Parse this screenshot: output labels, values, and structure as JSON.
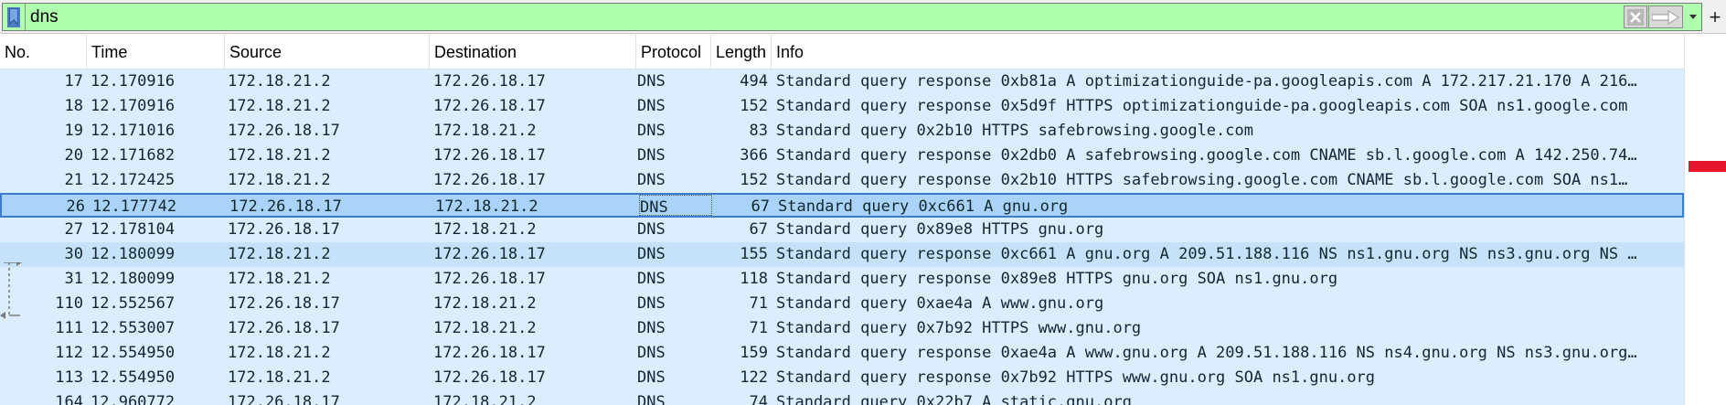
{
  "filter": {
    "value": "dns",
    "placeholder": ""
  },
  "toolbar": {
    "add_label": "+"
  },
  "columns": [
    "No.",
    "Time",
    "Source",
    "Destination",
    "Protocol",
    "Length",
    "Info"
  ],
  "packets": [
    {
      "no": "17",
      "time": "12.170916",
      "src": "172.18.21.2",
      "dst": "172.26.18.17",
      "proto": "DNS",
      "len": "494",
      "info": "Standard query response 0xb81a A optimizationguide-pa.googleapis.com A 172.217.21.170 A 216…",
      "style": "alt"
    },
    {
      "no": "18",
      "time": "12.170916",
      "src": "172.18.21.2",
      "dst": "172.26.18.17",
      "proto": "DNS",
      "len": "152",
      "info": "Standard query response 0x5d9f HTTPS optimizationguide-pa.googleapis.com SOA ns1.google.com",
      "style": "alt"
    },
    {
      "no": "19",
      "time": "12.171016",
      "src": "172.26.18.17",
      "dst": "172.18.21.2",
      "proto": "DNS",
      "len": "83",
      "info": "Standard query 0x2b10 HTTPS safebrowsing.google.com",
      "style": "alt"
    },
    {
      "no": "20",
      "time": "12.171682",
      "src": "172.18.21.2",
      "dst": "172.26.18.17",
      "proto": "DNS",
      "len": "366",
      "info": "Standard query response 0x2db0 A safebrowsing.google.com CNAME sb.l.google.com A 142.250.74…",
      "style": "alt"
    },
    {
      "no": "21",
      "time": "12.172425",
      "src": "172.18.21.2",
      "dst": "172.26.18.17",
      "proto": "DNS",
      "len": "152",
      "info": "Standard query response 0x2b10 HTTPS safebrowsing.google.com CNAME sb.l.google.com SOA ns1…",
      "style": "alt"
    },
    {
      "no": "26",
      "time": "12.177742",
      "src": "172.26.18.17",
      "dst": "172.18.21.2",
      "proto": "DNS",
      "len": "67",
      "info": "Standard query 0xc661 A gnu.org",
      "style": "selected"
    },
    {
      "no": "27",
      "time": "12.178104",
      "src": "172.26.18.17",
      "dst": "172.18.21.2",
      "proto": "DNS",
      "len": "67",
      "info": "Standard query 0x89e8 HTTPS gnu.org",
      "style": "alt"
    },
    {
      "no": "30",
      "time": "12.180099",
      "src": "172.18.21.2",
      "dst": "172.26.18.17",
      "proto": "DNS",
      "len": "155",
      "info": "Standard query response 0xc661 A gnu.org A 209.51.188.116 NS ns1.gnu.org NS ns3.gnu.org NS …",
      "style": "dark"
    },
    {
      "no": "31",
      "time": "12.180099",
      "src": "172.18.21.2",
      "dst": "172.26.18.17",
      "proto": "DNS",
      "len": "118",
      "info": "Standard query response 0x89e8 HTTPS gnu.org SOA ns1.gnu.org",
      "style": "alt"
    },
    {
      "no": "110",
      "time": "12.552567",
      "src": "172.26.18.17",
      "dst": "172.18.21.2",
      "proto": "DNS",
      "len": "71",
      "info": "Standard query 0xae4a A www.gnu.org",
      "style": "alt"
    },
    {
      "no": "111",
      "time": "12.553007",
      "src": "172.26.18.17",
      "dst": "172.18.21.2",
      "proto": "DNS",
      "len": "71",
      "info": "Standard query 0x7b92 HTTPS www.gnu.org",
      "style": "alt"
    },
    {
      "no": "112",
      "time": "12.554950",
      "src": "172.18.21.2",
      "dst": "172.26.18.17",
      "proto": "DNS",
      "len": "159",
      "info": "Standard query response 0xae4a A www.gnu.org A 209.51.188.116 NS ns4.gnu.org NS ns3.gnu.org…",
      "style": "alt"
    },
    {
      "no": "113",
      "time": "12.554950",
      "src": "172.18.21.2",
      "dst": "172.26.18.17",
      "proto": "DNS",
      "len": "122",
      "info": "Standard query response 0x7b92 HTTPS www.gnu.org SOA ns1.gnu.org",
      "style": "alt"
    },
    {
      "no": "164",
      "time": "12.960772",
      "src": "172.26.18.17",
      "dst": "172.18.21.2",
      "proto": "DNS",
      "len": "74",
      "info": "Standard query 0x22b7 A static.gnu.org",
      "style": "alt"
    }
  ],
  "colors": {
    "filter_valid": "#afffaf",
    "row_bg": "#daeeff",
    "selected_bg": "#a9d3f9",
    "marker": "#e6162c"
  },
  "icons": {
    "bookmark": "bookmark-icon",
    "clear": "clear-icon",
    "apply": "arrow-right-icon",
    "dropdown": "chevron-down-icon",
    "add": "plus-icon"
  }
}
